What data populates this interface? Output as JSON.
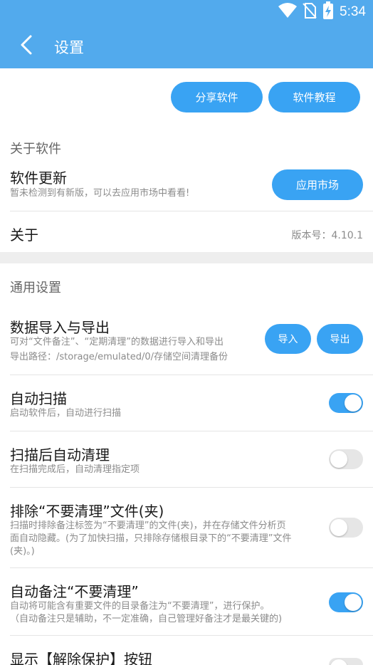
{
  "status_bar": {
    "time": "5:34",
    "icons": [
      "wifi-icon",
      "no-sim-icon",
      "battery-charging-icon"
    ]
  },
  "app_bar": {
    "title": "设置",
    "back_icon": "chevron-left-icon"
  },
  "top_buttons": {
    "share": "分享软件",
    "tutorial": "软件教程"
  },
  "about_section": {
    "header": "关于软件",
    "update": {
      "title": "软件更新",
      "desc": "暂未检测到有新版，可以去应用市场中看看!",
      "button": "应用市场"
    },
    "about": {
      "title": "关于",
      "version": "版本号：4.10.1"
    }
  },
  "general_section": {
    "header": "通用设置",
    "data_io": {
      "title": "数据导入与导出",
      "desc1": "可对“文件备注”、“定期清理”的数据进行导入和导出",
      "desc2": "导出路径：/storage/emulated/0/存储空间清理备份",
      "import": "导入",
      "export": "导出"
    },
    "auto_scan": {
      "title": "自动扫描",
      "desc": "启动软件后，自动进行扫描",
      "enabled": true
    },
    "auto_clean": {
      "title": "扫描后自动清理",
      "desc": "在扫描完成后，自动清理指定项",
      "enabled": false
    },
    "exclude": {
      "title": "排除“不要清理”文件(夹)",
      "desc1": "扫描时排除备注标签为“不要清理”的文件(夹)，并在存储文件分析页",
      "desc2": "面自动隐藏。(为了加快扫描，只排除存储根目录下的“不要清理”文件",
      "desc3": "(夹)。)",
      "enabled": false
    },
    "auto_note": {
      "title": "自动备注“不要清理”",
      "desc1": "自动将可能含有重要文件的目录备注为“不要清理”，进行保护。",
      "desc2": "（自动备注只是辅助，不一定准确，自己管理好备注才是最关键的)",
      "enabled": true
    },
    "show_unprotect": {
      "title": "显示【解除保护】按钮",
      "enabled": false
    }
  }
}
